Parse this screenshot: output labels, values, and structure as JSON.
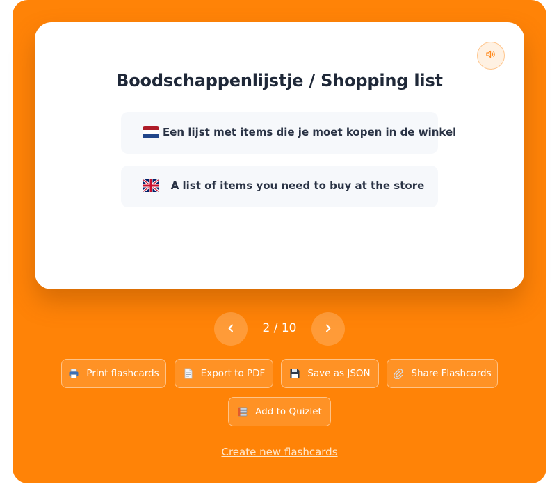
{
  "card": {
    "title": "Boodschappenlijstje / Shopping list",
    "audio_icon": "speaker-icon",
    "translations": [
      {
        "language": "Dutch",
        "flag": "netherlands-flag-icon",
        "text": "Een lijst met items die je moet kopen in de winkel"
      },
      {
        "language": "English",
        "flag": "uk-flag-icon",
        "text": "A list of items you need to buy at the store"
      }
    ]
  },
  "navigation": {
    "prev_icon": "chevron-left-icon",
    "next_icon": "chevron-right-icon",
    "counter": "2 / 10",
    "current": 2,
    "total": 10
  },
  "actions": {
    "print": {
      "label": "Print flashcards",
      "icon": "printer-icon"
    },
    "export_pdf": {
      "label": "Export to PDF",
      "icon": "document-icon"
    },
    "save_json": {
      "label": "Save as JSON",
      "icon": "floppy-disk-icon"
    },
    "share": {
      "label": "Share Flashcards",
      "icon": "paperclip-icon"
    },
    "quizlet": {
      "label": "Add to Quizlet",
      "icon": "stack-icon"
    }
  },
  "create_link": "Create new flashcards",
  "colors": {
    "accent": "#ff8307",
    "card_bg": "#ffffff",
    "row_bg": "#f6f8fb",
    "title_text": "#1f2838"
  }
}
